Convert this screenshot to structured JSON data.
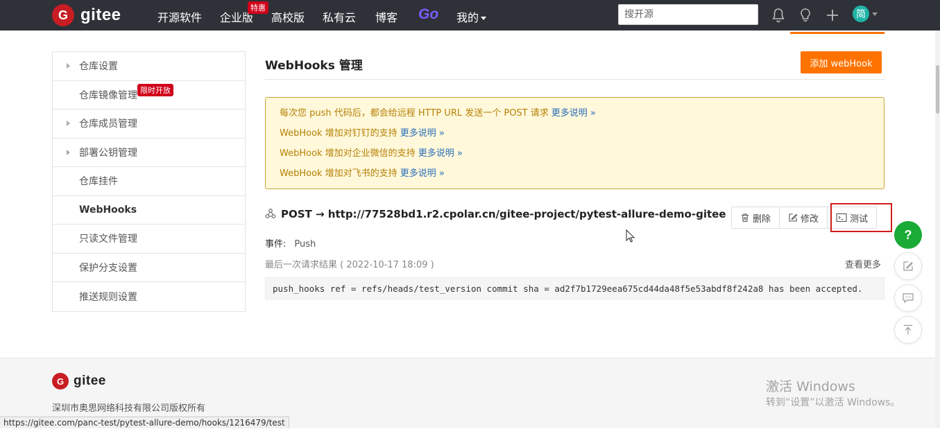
{
  "colors": {
    "nav_bg": "#2e3138",
    "brand_red": "#c71d23",
    "accent_orange": "#fe7300",
    "link_blue": "#2a6eb8",
    "notice_text": "#b58105",
    "help_green": "#1aab36"
  },
  "header": {
    "logo_mark": "G",
    "logo_text": "gitee",
    "nav": [
      {
        "label": "开源软件"
      },
      {
        "label": "企业版",
        "badge": "特惠"
      },
      {
        "label": "高校版"
      },
      {
        "label": "私有云"
      },
      {
        "label": "博客"
      }
    ],
    "go_label": "Go",
    "mine_label": "我的",
    "search_placeholder": "搜开源",
    "icons": [
      "bell-icon",
      "lightbulb-icon",
      "plus-icon"
    ],
    "avatar_text": "简"
  },
  "sidebar": {
    "items": [
      {
        "label": "仓库设置",
        "expandable": true
      },
      {
        "label": "仓库镜像管理",
        "badge": "限时开放"
      },
      {
        "label": "仓库成员管理",
        "expandable": true
      },
      {
        "label": "部署公钥管理",
        "expandable": true
      },
      {
        "label": "仓库挂件"
      },
      {
        "label": "WebHooks",
        "active": true
      },
      {
        "label": "只读文件管理"
      },
      {
        "label": "保护分支设置"
      },
      {
        "label": "推送规则设置"
      }
    ]
  },
  "main": {
    "title": "WebHooks 管理",
    "add_button": "添加 webHook",
    "notices": [
      {
        "text": "每次您 push 代码后，都会给远程 HTTP URL 发送一个 POST 请求",
        "link": "更多说明 »"
      },
      {
        "text": "WebHook 增加对钉钉的支持",
        "link": "更多说明 »"
      },
      {
        "text": "WebHook 增加对企业微信的支持",
        "link": "更多说明 »"
      },
      {
        "text": "WebHook 增加对飞书的支持",
        "link": "更多说明 »"
      }
    ],
    "hook": {
      "url_text": "POST → http://77528bd1.r2.cpolar.cn/gitee-project/pytest-allure-demo-gitee",
      "delete_label": "删除",
      "edit_label": "修改",
      "test_label": "测试",
      "event_label": "事件:",
      "event_value": "Push",
      "last_result": "最后一次请求结果 ( 2022-10-17 18:09 )",
      "see_more": "查看更多",
      "response": "push_hooks ref = refs/heads/test_version commit sha = ad2f7b1729eea675cd44da48f5e53abdf8f242a8 has been accepted."
    }
  },
  "float_buttons": {
    "help_label": "?",
    "icons": [
      "edit-icon",
      "comment-icon",
      "back-to-top-icon"
    ]
  },
  "footer": {
    "logo_mark": "G",
    "logo_text": "gitee",
    "company": "深圳市奥思网络科技有限公司版权所有",
    "status_url": "https://gitee.com/panc-test/pytest-allure-demo/hooks/1216479/test",
    "windows_title": "激活 Windows",
    "windows_sub": "转到“设置”以激活 Windows。"
  }
}
